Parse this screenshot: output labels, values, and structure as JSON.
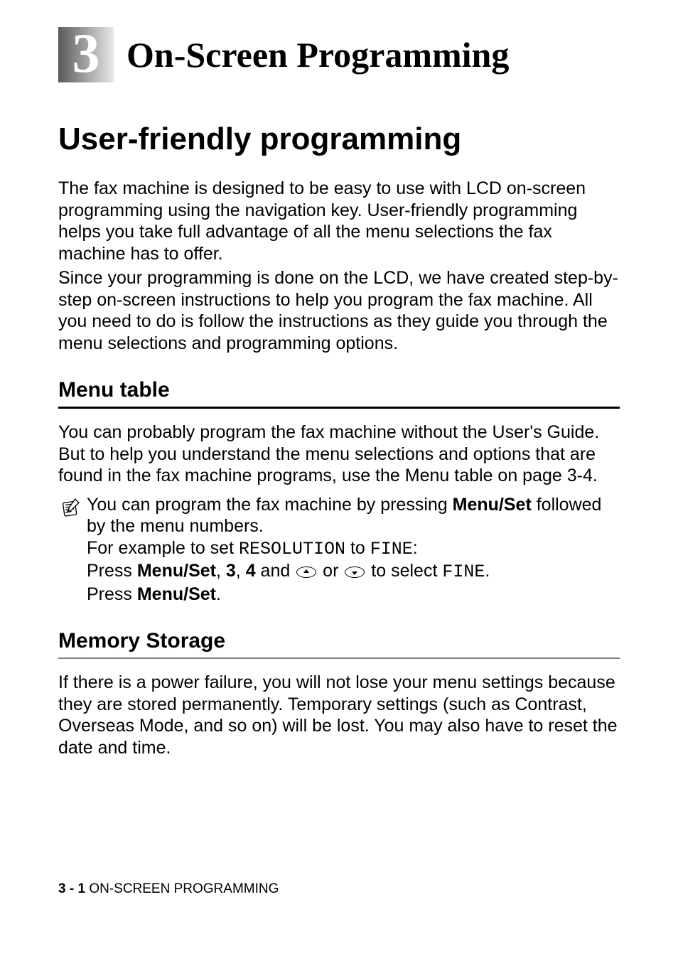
{
  "chapter": {
    "number": "3",
    "title": "On-Screen Programming"
  },
  "h1": "User-friendly programming",
  "intro": {
    "p1": "The fax machine is designed to be easy to use with LCD on-screen programming using the navigation key. User-friendly programming helps you take full advantage of all the menu selections the fax machine has to offer.",
    "p2": "Since your programming is done on the LCD, we have created step-by-step on-screen instructions to help you program the fax machine. All you need to do is follow the instructions as they guide you through the menu selections and programming options."
  },
  "menu_table": {
    "heading": "Menu table",
    "p1": "You can probably program the fax machine without the User's Guide. But to help you understand the menu selections and options that are found in the fax machine programs, use the Menu table on page 3-4.",
    "note": {
      "line1_a": "You can program the fax machine by pressing ",
      "line1_b": "Menu/Set",
      "line1_c": " followed by the menu numbers.",
      "line2_a": "For example to set ",
      "line2_b": "RESOLUTION",
      "line2_c": " to ",
      "line2_d": "FINE",
      "line2_e": ":",
      "line3_a": "Press ",
      "line3_b": "Menu/Set",
      "line3_c": ", ",
      "line3_d": "3",
      "line3_e": ", ",
      "line3_f": "4",
      "line3_g": " and ",
      "line3_h": " or ",
      "line3_i": " to select ",
      "line3_j": "FINE",
      "line3_k": ".",
      "line4_a": "Press ",
      "line4_b": "Menu/Set",
      "line4_c": "."
    }
  },
  "memory_storage": {
    "heading": "Memory Storage",
    "p1": "If there is a power failure, you will not lose your menu settings because they are stored permanently. Temporary settings (such as Contrast, Overseas Mode, and so on) will be lost. You may also have to reset the date and time."
  },
  "footer": {
    "page": "3 - 1",
    "sep": "   ",
    "section": "ON-SCREEN PROGRAMMING"
  }
}
